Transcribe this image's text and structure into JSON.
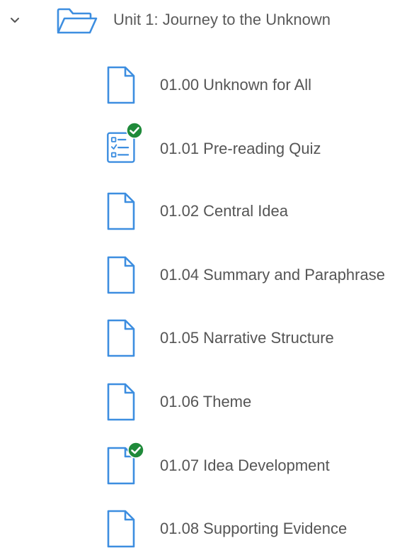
{
  "unit": {
    "title": "Unit 1: Journey to the Unknown",
    "expanded": true,
    "icon": "folder-open-icon"
  },
  "colors": {
    "icon_blue": "#3d8ee0",
    "check_green": "#1f8a3a",
    "text": "#555555"
  },
  "items": [
    {
      "label": "01.00 Unknown for All",
      "icon": "document-icon",
      "completed": false
    },
    {
      "label": "01.01 Pre-reading Quiz",
      "icon": "quiz-checklist-icon",
      "completed": true
    },
    {
      "label": "01.02 Central Idea",
      "icon": "document-icon",
      "completed": false
    },
    {
      "label": "01.04 Summary and Paraphrase",
      "icon": "document-icon",
      "completed": false
    },
    {
      "label": "01.05 Narrative Structure",
      "icon": "document-icon",
      "completed": false
    },
    {
      "label": "01.06 Theme",
      "icon": "document-icon",
      "completed": false
    },
    {
      "label": "01.07 Idea Development",
      "icon": "document-icon",
      "completed": true
    },
    {
      "label": "01.08 Supporting Evidence",
      "icon": "document-icon",
      "completed": false
    }
  ]
}
